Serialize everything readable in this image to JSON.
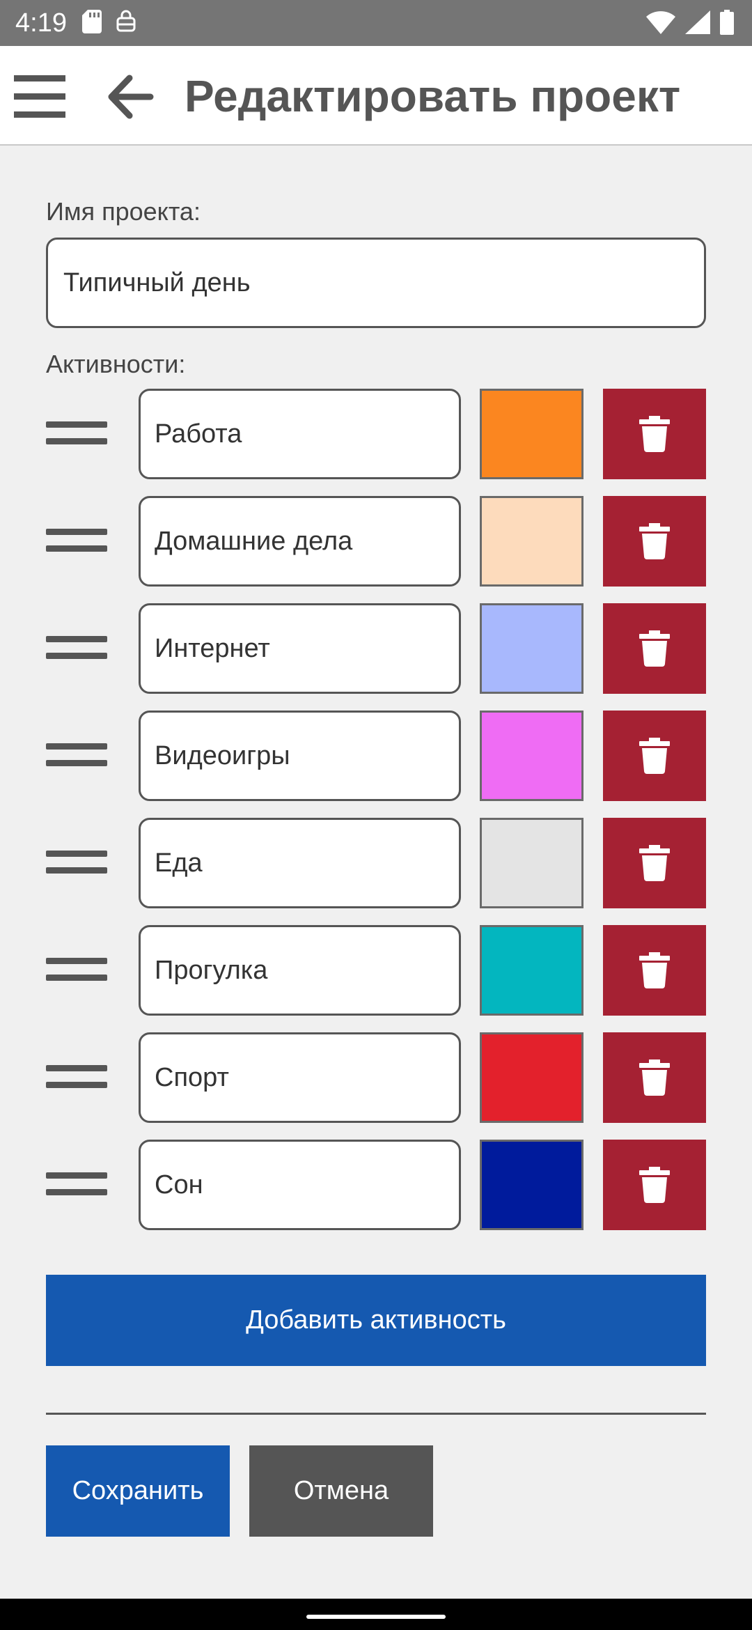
{
  "status_bar": {
    "time": "4:19",
    "icons": [
      "sd-card-icon",
      "vpn-key-icon",
      "wifi-icon",
      "signal-icon",
      "battery-icon"
    ]
  },
  "app_bar": {
    "menu_icon": "hamburger-menu-icon",
    "back_icon": "arrow-left-icon",
    "title": "Редактировать проект"
  },
  "form": {
    "project_name_label": "Имя проекта:",
    "project_name_value": "Типичный день",
    "activities_label": "Активности:",
    "activities": [
      {
        "name": "Работа",
        "color": "#fb8620"
      },
      {
        "name": "Домашние дела",
        "color": "#fddbbc"
      },
      {
        "name": "Интернет",
        "color": "#a8b8fd"
      },
      {
        "name": "Видеоигры",
        "color": "#ef6cf4"
      },
      {
        "name": "Еда",
        "color": "#e4e4e4"
      },
      {
        "name": "Прогулка",
        "color": "#03b6bf"
      },
      {
        "name": "Спорт",
        "color": "#e3212c"
      },
      {
        "name": "Сон",
        "color": "#001b9c"
      }
    ],
    "delete_icon": "trash-icon",
    "drag_icon": "drag-handle-icon"
  },
  "buttons": {
    "add_activity": "Добавить активность",
    "save": "Сохранить",
    "cancel": "Отмена"
  },
  "colors": {
    "primary": "#1559b0",
    "delete": "#a52133",
    "neutral_button": "#555555",
    "status_bar": "#757575"
  }
}
